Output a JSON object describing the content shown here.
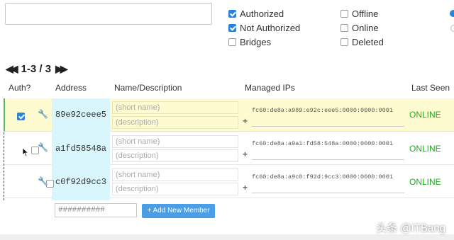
{
  "search": {
    "value": "",
    "placeholder": ""
  },
  "filters": [
    {
      "label": "Authorized",
      "checked": true
    },
    {
      "label": "Not Authorized",
      "checked": true
    },
    {
      "label": "Bridges",
      "checked": false
    },
    {
      "label": "Offline",
      "checked": false
    },
    {
      "label": "Online",
      "checked": false
    },
    {
      "label": "Deleted",
      "checked": false
    }
  ],
  "pager": {
    "range": "1-3 / 3",
    "prev_icon": "rewind-icon",
    "next_icon": "fast-forward-icon"
  },
  "columns": [
    "Auth?",
    "Address",
    "Name/Description",
    "Managed IPs",
    "Last Seen"
  ],
  "members": [
    {
      "authorized": true,
      "address": "89e92ceee5",
      "name_placeholder": "(short name)",
      "desc_placeholder": "(description)",
      "ip": "fc60:de8a:a989:e92c:eee5:0000:0000:0001",
      "status": "ONLINE"
    },
    {
      "authorized": false,
      "address": "a1fd58548a",
      "name_placeholder": "(short name)",
      "desc_placeholder": "(description)",
      "ip": "fc60:de8a:a9a1:fd58:548a:0000:0000:0001",
      "status": "ONLINE"
    },
    {
      "authorized": false,
      "address": "c0f92d9cc3",
      "name_placeholder": "(short name)",
      "desc_placeholder": "(description)",
      "ip": "fc60:de8a:a9c0:f92d:9cc3:0000:0000:0001",
      "status": "ONLINE"
    }
  ],
  "new_member": {
    "placeholder": "##########",
    "button_label": "+ Add New Member"
  },
  "watermark": "头条 @ITBang",
  "colors": {
    "accent": "#2a82d9",
    "online": "#22aa22",
    "authorized_row": "#fffbd1",
    "address_column": "#d8f6fb"
  }
}
